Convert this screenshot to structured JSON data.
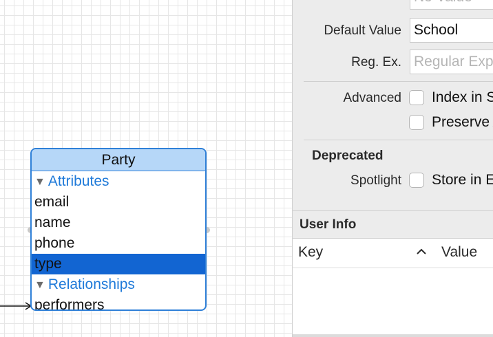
{
  "entity": {
    "name": "Party",
    "attributes_header": "Attributes",
    "attributes": [
      "email",
      "name",
      "phone",
      "type"
    ],
    "selected_attribute": "type",
    "relationships_header": "Relationships",
    "relationships": [
      "performers"
    ]
  },
  "inspector": {
    "top_field_placeholder": "No Value",
    "default_value_label": "Default Value",
    "default_value": "School",
    "regex_label": "Reg. Ex.",
    "regex_placeholder": "Regular Expression",
    "advanced_label": "Advanced",
    "index_in_spotlight_label": "Index in Spotlight",
    "preserve_label": "Preserve After Deletion",
    "deprecated_title": "Deprecated",
    "spotlight_label": "Spotlight",
    "store_in_label": "Store in External Record File",
    "user_info_title": "User Info",
    "user_info_columns": {
      "key": "Key",
      "value": "Value"
    },
    "user_info_rows": []
  },
  "colors": {
    "selection": "#1265d2",
    "entity_border": "#2f80d8",
    "entity_header": "#b6d7f8",
    "section_text": "#1f7ad9"
  }
}
